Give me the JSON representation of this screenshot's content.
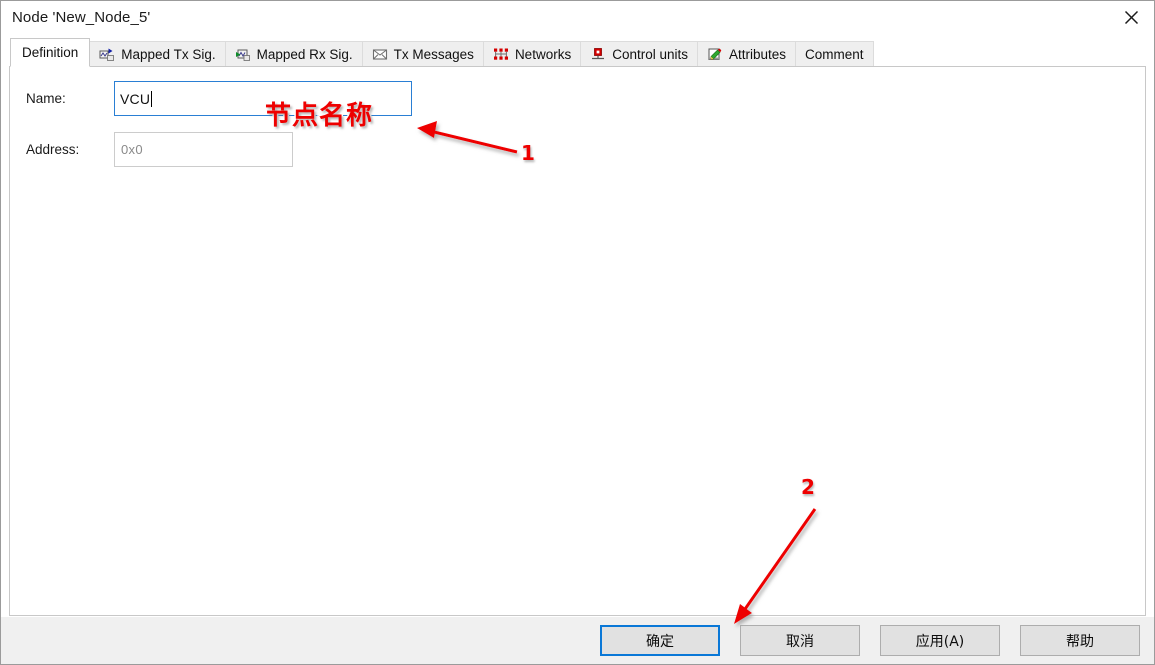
{
  "window": {
    "title": "Node 'New_Node_5'",
    "close_icon": "close-icon"
  },
  "tabs": [
    {
      "label": "Definition",
      "icon": "none",
      "active": true
    },
    {
      "label": "Mapped Tx Sig.",
      "icon": "tx-signal-icon",
      "active": false
    },
    {
      "label": "Mapped Rx Sig.",
      "icon": "rx-signal-icon",
      "active": false
    },
    {
      "label": "Tx Messages",
      "icon": "envelope-icon",
      "active": false
    },
    {
      "label": "Networks",
      "icon": "network-tree-icon",
      "active": false
    },
    {
      "label": "Control units",
      "icon": "control-unit-icon",
      "active": false
    },
    {
      "label": "Attributes",
      "icon": "pencil-page-icon",
      "active": false
    },
    {
      "label": "Comment",
      "icon": "none",
      "active": false
    }
  ],
  "form": {
    "name": {
      "label": "Name:",
      "value": "VCU",
      "placeholder": ""
    },
    "address": {
      "label": "Address:",
      "value": "0x0",
      "placeholder": "0x0"
    }
  },
  "footer": {
    "buttons": [
      {
        "label": "确定",
        "name": "ok-button",
        "default": true
      },
      {
        "label": "取消",
        "name": "cancel-button",
        "default": false
      },
      {
        "label": "应用(A)",
        "name": "apply-button",
        "default": false
      },
      {
        "label": "帮助",
        "name": "help-button",
        "default": false
      }
    ]
  },
  "annotations": {
    "name_field_callout": "节点名称",
    "marker_one": "1",
    "marker_two": "2"
  },
  "colors": {
    "accent_blue": "#0a78d7",
    "focus_border": "#2a7fd4",
    "annotation_red": "#ee0000",
    "footer_bg": "#f0f0f0",
    "tab_inactive_bg": "#efefef"
  }
}
